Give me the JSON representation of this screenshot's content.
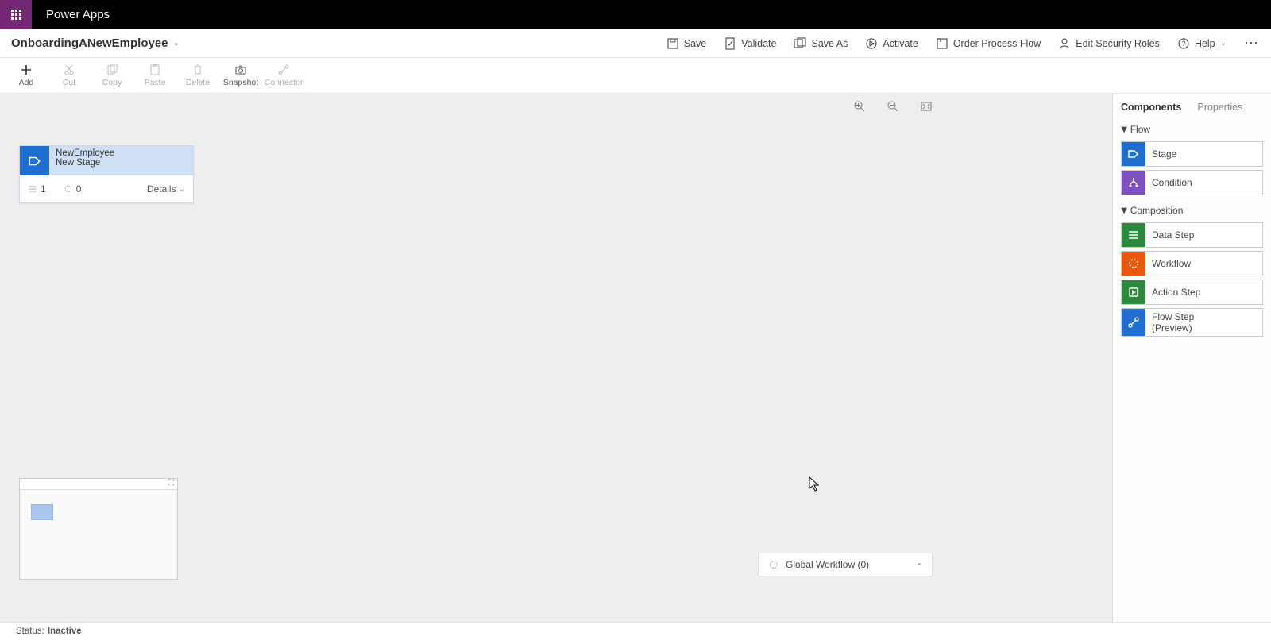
{
  "header": {
    "product": "Power Apps"
  },
  "titlebar": {
    "flow_name": "OnboardingANewEmployee",
    "actions": {
      "save": "Save",
      "validate": "Validate",
      "save_as": "Save As",
      "activate": "Activate",
      "order": "Order Process Flow",
      "security": "Edit Security Roles",
      "help": "Help"
    }
  },
  "toolbar": {
    "add": "Add",
    "cut": "Cut",
    "copy": "Copy",
    "paste": "Paste",
    "delete": "Delete",
    "snapshot": "Snapshot",
    "connector": "Connector"
  },
  "stage": {
    "line1": "NewEmployee",
    "line2": "New Stage",
    "steps": "1",
    "triggers": "0",
    "details": "Details"
  },
  "global_workflow": {
    "label": "Global Workflow (0)"
  },
  "panel": {
    "tab_components": "Components",
    "tab_properties": "Properties",
    "section_flow": "Flow",
    "section_composition": "Composition",
    "items": {
      "stage": "Stage",
      "condition": "Condition",
      "data_step": "Data Step",
      "workflow": "Workflow",
      "action_step": "Action Step",
      "flow_step": "Flow Step\n(Preview)"
    }
  },
  "status": {
    "label": "Status:",
    "value": "Inactive"
  }
}
